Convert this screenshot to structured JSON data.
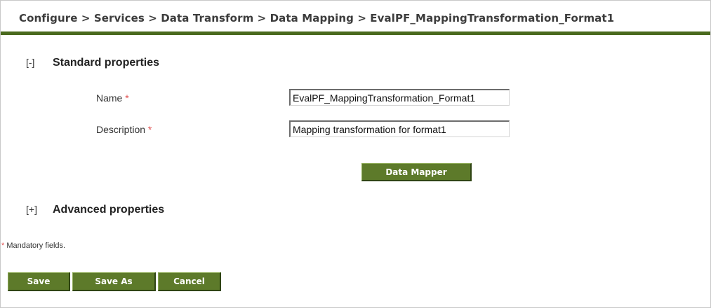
{
  "breadcrumb": "Configure > Services > Data Transform > Data Mapping > EvalPF_MappingTransformation_Format1",
  "standard_section": {
    "toggle": "[-]",
    "title": "Standard properties"
  },
  "fields": {
    "name": {
      "label": "Name",
      "required_mark": "*",
      "value": "EvalPF_MappingTransformation_Format1"
    },
    "description": {
      "label": "Description",
      "required_mark": "*",
      "value": "Mapping transformation for format1"
    }
  },
  "data_mapper_button": "Data Mapper",
  "advanced_section": {
    "toggle": "[+]",
    "title": "Advanced properties"
  },
  "mandatory_note": {
    "mark": "*",
    "text": " Mandatory fields."
  },
  "actions": {
    "save": "Save",
    "save_as": "Save As",
    "cancel": "Cancel"
  },
  "colors": {
    "accent_bar": "#4a6a1e",
    "button_bg": "#5d7a2a",
    "required": "#e05050"
  }
}
